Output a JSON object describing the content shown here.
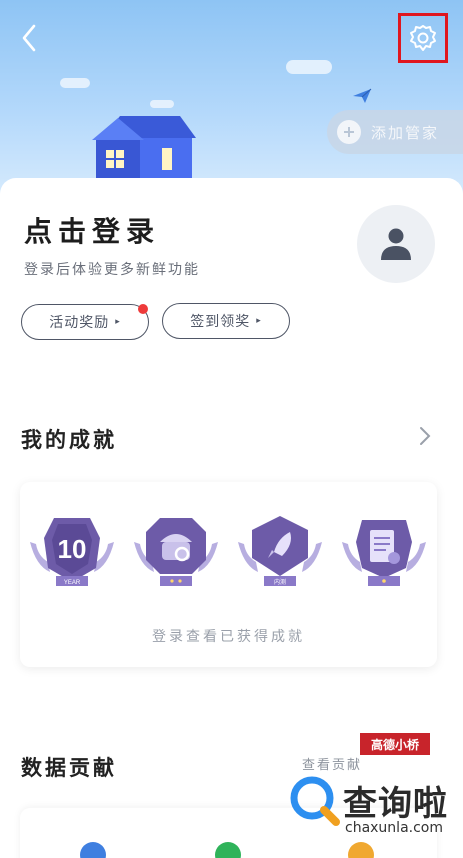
{
  "header": {
    "add_assistant_label": "添加管家"
  },
  "profile": {
    "login_title": "点击登录",
    "login_subtitle": "登录后体验更多新鲜功能",
    "buttons": [
      {
        "label": "活动奖励",
        "arrow": "▸",
        "has_red_dot": true
      },
      {
        "label": "签到领奖",
        "arrow": "▸",
        "has_red_dot": false
      }
    ]
  },
  "achievements": {
    "title": "我的成就",
    "badges": [
      {
        "icon": "year-10-badge",
        "text": "10",
        "sub": "YEAR"
      },
      {
        "icon": "detective-badge"
      },
      {
        "icon": "rocket-badge",
        "sub": "内测"
      },
      {
        "icon": "document-badge"
      }
    ],
    "hint": "登录查看已获得成就"
  },
  "data_contribution": {
    "title": "数据贡献",
    "more_label": "查看贡献"
  },
  "watermark": {
    "banner": "高德小桥",
    "name": "查询啦",
    "url": "chaxunla.com"
  },
  "colors": {
    "accent_red": "#e0161e",
    "badge_purple": "#6d5ba8",
    "sky": "#a8d1f8"
  }
}
